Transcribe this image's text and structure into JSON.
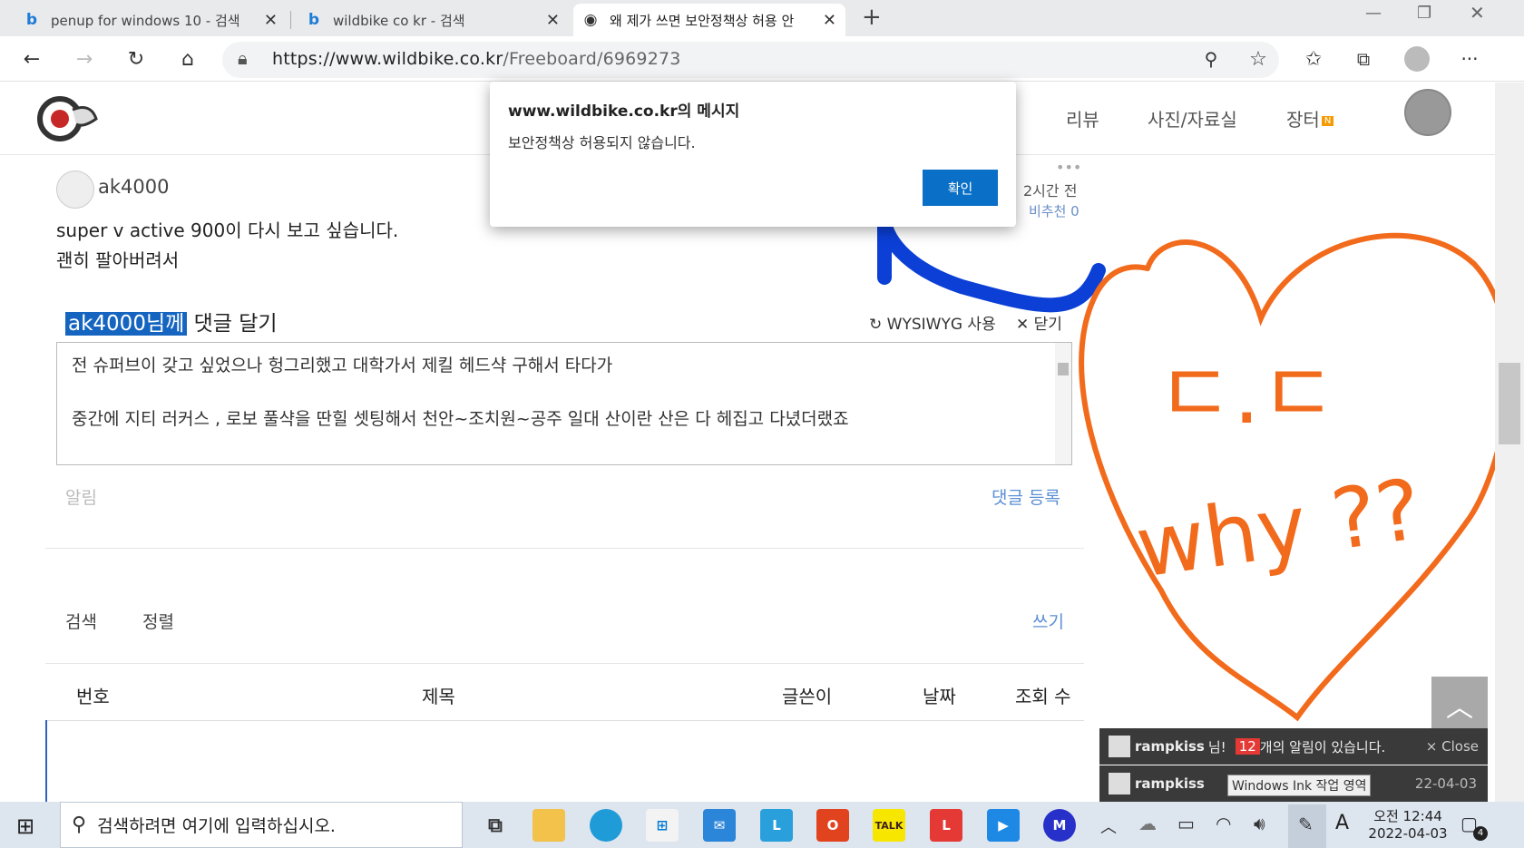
{
  "browser": {
    "tabs": [
      {
        "title": "penup for windows 10 - 검색"
      },
      {
        "title": "wildbike co kr - 검색"
      },
      {
        "title": "왜 제가 쓰면 보안정책상 허용 안"
      }
    ],
    "new_tab": "+",
    "url_host": "https://www.wildbike.co.kr",
    "url_path": "/Freeboard/6969273"
  },
  "site": {
    "nav": [
      "리뷰",
      "사진/자료실",
      "장터"
    ],
    "nav_badge": "N"
  },
  "post": {
    "author": "ak4000",
    "time": "2시간 전",
    "recommend": "비추천 0",
    "body_line1": "super v active 900이 다시 보고 싶습니다.",
    "body_line2": "괜히 팔아버려서"
  },
  "comment": {
    "target": "ak4000님께",
    "heading": "댓글 달기",
    "wysiwyg": "WYSIWYG 사용",
    "close": "닫기",
    "text_line1": "전 슈퍼브이 갖고 싶었으나 헝그리했고 대학가서 제킬 헤드샥 구해서 타다가",
    "text_line2": "중간에 지티 러커스 , 로보 풀샥을 딴힐 셋팅해서 천안~조치원~공주 일대 산이란 산은 다 헤집고 다녔더랬죠",
    "notify": "알림",
    "submit": "댓글 등록"
  },
  "list": {
    "search": "검색",
    "sort": "정렬",
    "write": "쓰기",
    "headers": [
      "번호",
      "제목",
      "글쓴이",
      "날짜",
      "조회 수"
    ]
  },
  "dialog": {
    "title": "www.wildbike.co.kr의 메시지",
    "message": "보안정책상 허용되지 않습니다.",
    "ok": "확인"
  },
  "annotation": {
    "line1": "ㄷ.ㄷ",
    "line2": "why ??"
  },
  "notifications": {
    "user": "rampkiss",
    "suffix_1": "님!",
    "count": "12",
    "message": "개의 알림이 있습니다.",
    "close": "× Close",
    "second_date": "22-04-03",
    "tooltip": "Windows Ink 작업 영역"
  },
  "taskbar": {
    "search_placeholder": "검색하려면 여기에 입력하십시오.",
    "time": "오전 12:44",
    "date": "2022-04-03",
    "ime": "A",
    "notif_count": "4"
  },
  "colors": {
    "accent": "#0a6fc7",
    "highlight": "#1565c0",
    "ink_blue": "#0b3fd6",
    "ink_orange": "#f26a1b"
  }
}
